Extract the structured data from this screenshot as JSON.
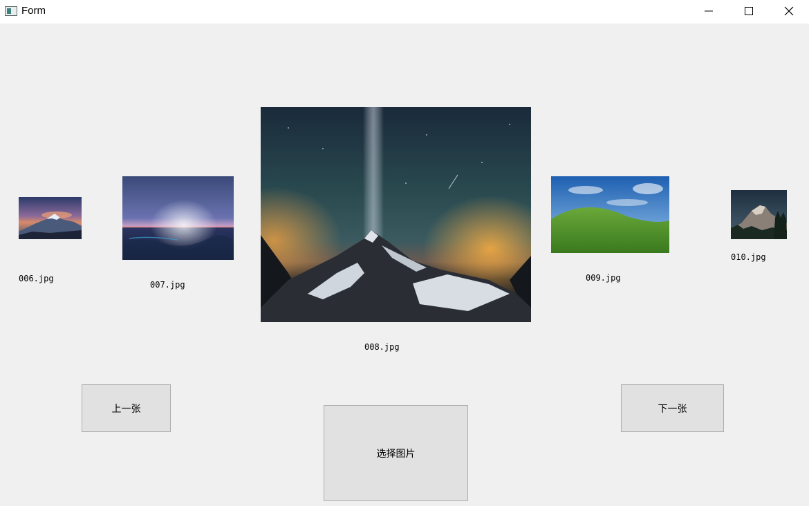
{
  "window": {
    "title": "Form"
  },
  "images": {
    "i006": {
      "caption": "006.jpg"
    },
    "i007": {
      "caption": "007.jpg"
    },
    "i008": {
      "caption": "008.jpg"
    },
    "i009": {
      "caption": "009.jpg"
    },
    "i010": {
      "caption": "010.jpg"
    }
  },
  "buttons": {
    "prev": "上一张",
    "next": "下一张",
    "select": "选择图片"
  }
}
